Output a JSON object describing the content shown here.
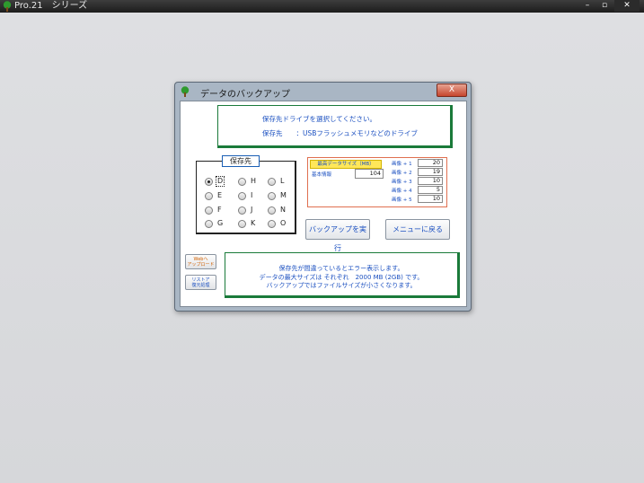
{
  "app": {
    "title": "Pro.21　シリーズ"
  },
  "window_controls": {
    "minimize": "–",
    "maximize": "▫",
    "close": "✕"
  },
  "dialog": {
    "title": "データのバックアップ",
    "close": "X",
    "info_top": {
      "line1": "保存先ドライブを選択してください。",
      "line2": "保存先　　：USBフラッシュメモリなどのドライブ"
    },
    "group_label": "保存先",
    "drives": [
      {
        "label": "D",
        "selected": true
      },
      {
        "label": "E",
        "selected": false
      },
      {
        "label": "F",
        "selected": false
      },
      {
        "label": "G",
        "selected": false
      },
      {
        "label": "H",
        "selected": false
      },
      {
        "label": "I",
        "selected": false
      },
      {
        "label": "J",
        "selected": false
      },
      {
        "label": "K",
        "selected": false
      },
      {
        "label": "L",
        "selected": false
      },
      {
        "label": "M",
        "selected": false
      },
      {
        "label": "N",
        "selected": false
      },
      {
        "label": "O",
        "selected": false
      }
    ],
    "size_panel": {
      "header": "最高データサイズ（MB）",
      "basic_label": "基本情報",
      "basic_value": "104",
      "rows": [
        {
          "label": "画像 + 1",
          "value": "20"
        },
        {
          "label": "画像 + 2",
          "value": "19"
        },
        {
          "label": "画像 + 3",
          "value": "10"
        },
        {
          "label": "画像 + 4",
          "value": "5"
        },
        {
          "label": "画像 + 5",
          "value": "10"
        }
      ]
    },
    "buttons": {
      "backup": "バックアップを実行",
      "menu": "メニューに戻る",
      "upload_line1": "Webへ",
      "upload_line2": "アップロード",
      "restore_line1": "リストア",
      "restore_line2": "復元処理"
    },
    "info_bottom": {
      "line1": "保存先が間違っているとエラー表示します。",
      "line2": "データの最大サイズは それぞれ　2000 MB (2GB) です。",
      "line3": "バックアップではファイルサイズが小さくなります。"
    }
  },
  "colors": {
    "accent_blue": "#1a4fc0",
    "panel_green": "#1a7a3a",
    "header_yellow": "#ffe75a"
  }
}
